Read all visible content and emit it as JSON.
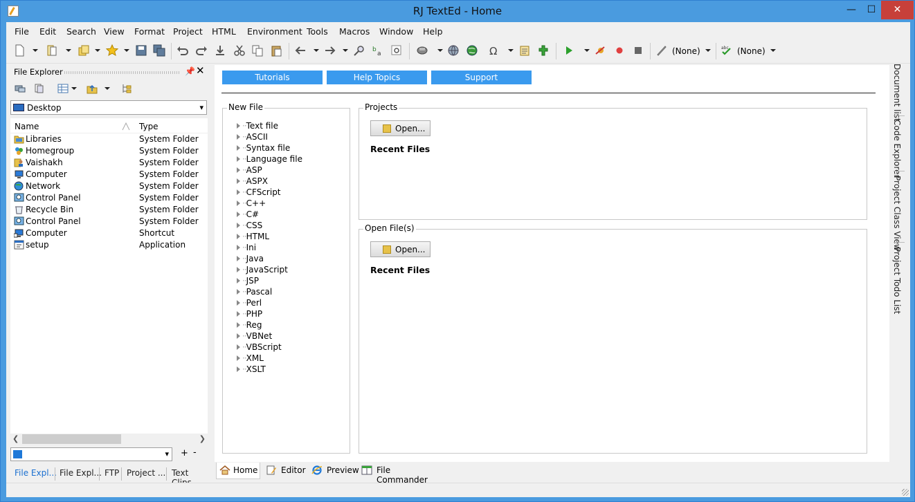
{
  "window": {
    "title": "RJ TextEd - Home",
    "minimize": "—",
    "maximize": "☐",
    "close": "✕"
  },
  "menu": [
    {
      "label": "File"
    },
    {
      "label": "Edit"
    },
    {
      "label": "Search"
    },
    {
      "label": "View"
    },
    {
      "label": "Format"
    },
    {
      "label": "Project"
    },
    {
      "label": "HTML"
    },
    {
      "label": "Environment"
    },
    {
      "label": "Tools"
    },
    {
      "label": "Macros"
    },
    {
      "label": "Window"
    },
    {
      "label": "Help"
    }
  ],
  "toolbar": {
    "syntax_value": "(None)",
    "spell_value": "(None)"
  },
  "file_explorer": {
    "title": "File Explorer",
    "location": "Desktop",
    "columns": [
      "Name",
      "Type"
    ],
    "rows": [
      {
        "name": "Libraries",
        "type": "System Folder",
        "icon": "libraries-icon"
      },
      {
        "name": "Homegroup",
        "type": "System Folder",
        "icon": "homegroup-icon"
      },
      {
        "name": "Vaishakh",
        "type": "System Folder",
        "icon": "user-folder-icon"
      },
      {
        "name": "Computer",
        "type": "System Folder",
        "icon": "computer-icon"
      },
      {
        "name": "Network",
        "type": "System Folder",
        "icon": "network-icon"
      },
      {
        "name": "Control Panel",
        "type": "System Folder",
        "icon": "control-panel-icon"
      },
      {
        "name": "Recycle Bin",
        "type": "System Folder",
        "icon": "recycle-bin-icon"
      },
      {
        "name": "Control Panel",
        "type": "System Folder",
        "icon": "control-panel-icon"
      },
      {
        "name": "Computer",
        "type": "Shortcut",
        "icon": "computer-icon"
      },
      {
        "name": "setup",
        "type": "Application",
        "icon": "application-icon"
      }
    ],
    "filter_value": "",
    "add_label": "+",
    "remove_label": "-"
  },
  "left_tabs": [
    {
      "label": "File Expl..."
    },
    {
      "label": "File Expl..."
    },
    {
      "label": "FTP"
    },
    {
      "label": "Project ..."
    },
    {
      "label": "Text Clips"
    }
  ],
  "home": {
    "links": [
      {
        "label": "Tutorials"
      },
      {
        "label": "Help Topics"
      },
      {
        "label": "Support"
      }
    ],
    "new_file": {
      "title": "New File",
      "items": [
        "Text file",
        "ASCII",
        "Syntax file",
        "Language file",
        "ASP",
        "ASPX",
        "CFScript",
        "C++",
        "C#",
        "CSS",
        "HTML",
        "Ini",
        "Java",
        "JavaScript",
        "JSP",
        "Pascal",
        "Perl",
        "PHP",
        "Reg",
        "VBNet",
        "VBScript",
        "XML",
        "XSLT"
      ]
    },
    "projects": {
      "title": "Projects",
      "open_label": "Open...",
      "recent_label": "Recent Files"
    },
    "open_files": {
      "title": "Open File(s)",
      "open_label": "Open...",
      "recent_label": "Recent Files"
    }
  },
  "doc_tabs": [
    {
      "label": "Home",
      "icon": "home-icon",
      "active": true
    },
    {
      "label": "Editor",
      "icon": "editor-icon",
      "active": false
    },
    {
      "label": "Preview",
      "icon": "internet-explorer-icon",
      "active": false
    },
    {
      "label": "File Commander",
      "icon": "file-commander-icon",
      "active": false
    }
  ],
  "right_dock": [
    {
      "label": "Document list"
    },
    {
      "label": "Code Explorer"
    },
    {
      "label": "Project Class View"
    },
    {
      "label": "Project Todo List"
    }
  ]
}
